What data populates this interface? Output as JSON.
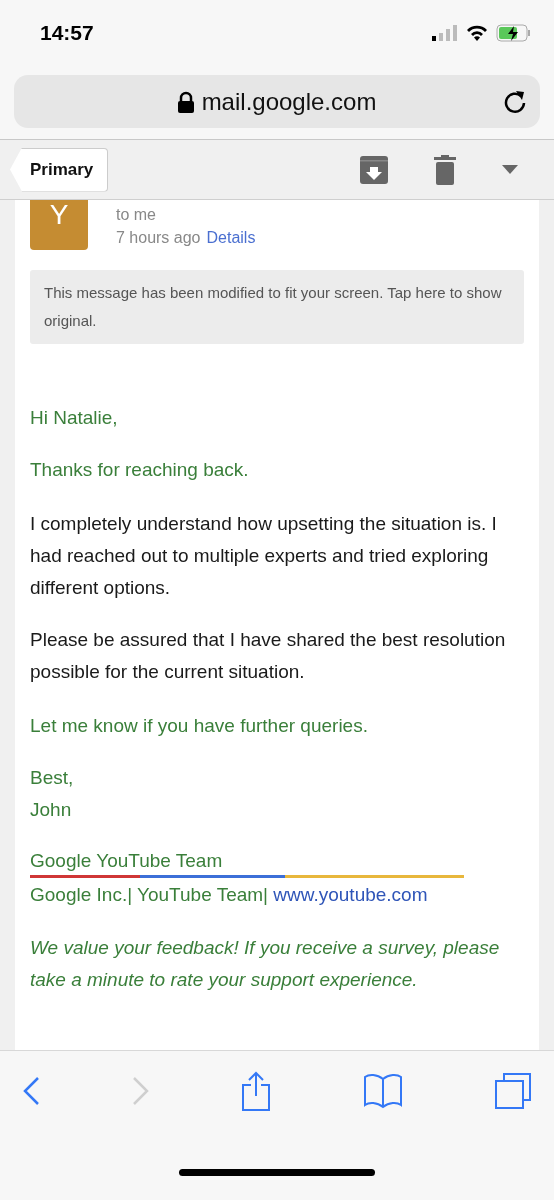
{
  "status_bar": {
    "time": "14:57"
  },
  "address_bar": {
    "url": "mail.google.com"
  },
  "mail_toolbar": {
    "back_label": "Primary"
  },
  "message": {
    "avatar_letter": "Y",
    "recipient": "to me",
    "time": "7 hours ago",
    "details_link": "Details",
    "notice": "This message has been modified to fit your screen. Tap here to show original.",
    "body": [
      {
        "paragraphs": [
          {
            "kind": "green",
            "text": "Hi Natalie,"
          },
          {
            "kind": "green",
            "text": "Thanks for reaching back."
          }
        ]
      },
      {
        "paragraphs": [
          {
            "kind": "black",
            "text": "I completely understand how upsetting the situation is. I had reached out to multiple experts and tried exploring different options."
          },
          {
            "kind": "black",
            "text": "Please be assured that I have shared the best resolution possible for the current situation."
          }
        ]
      },
      {
        "paragraphs": [
          {
            "kind": "green",
            "text": "Let me know if you have further queries."
          },
          {
            "kind": "green",
            "text": "Best,\nJohn"
          }
        ]
      }
    ],
    "signature": {
      "name": "Google YouTube Team",
      "company": "Google Inc.| YouTube Team| ",
      "link": "www.youtube.com",
      "feedback": "We value your feedback! If you receive a survey, please take a minute to rate your support experience."
    }
  },
  "browser_toolbar": [
    {
      "kind": "back",
      "disabled": false
    },
    {
      "kind": "forward",
      "disabled": true
    },
    {
      "kind": "share",
      "disabled": false
    },
    {
      "kind": "bookmarks",
      "disabled": false
    },
    {
      "kind": "tabs",
      "disabled": false
    }
  ]
}
